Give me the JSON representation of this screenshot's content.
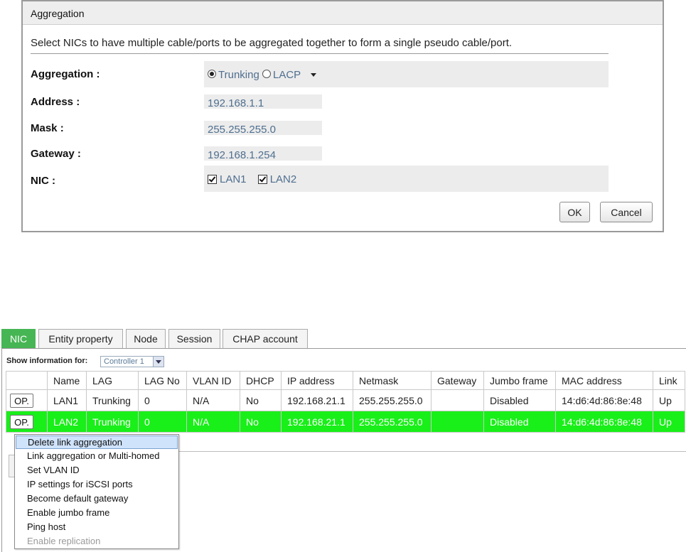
{
  "dialog": {
    "title": "Aggregation",
    "description": "Select NICs to have multiple cable/ports to be aggregated together to form a single pseudo cable/port.",
    "aggregation_label": "Aggregation :",
    "aggregation_options": [
      "Trunking",
      "LACP"
    ],
    "aggregation_selected": "Trunking",
    "address_label": "Address :",
    "address_value": "192.168.1.1",
    "mask_label": "Mask :",
    "mask_value": "255.255.255.0",
    "gateway_label": "Gateway :",
    "gateway_value": "192.168.1.254",
    "nic_label": "NIC :",
    "nic_options": [
      {
        "label": "LAN1",
        "checked": true
      },
      {
        "label": "LAN2",
        "checked": true
      }
    ],
    "ok_label": "OK",
    "cancel_label": "Cancel"
  },
  "tabs": [
    {
      "label": "NIC",
      "active": true
    },
    {
      "label": "Entity property",
      "active": false
    },
    {
      "label": "Node",
      "active": false
    },
    {
      "label": "Session",
      "active": false
    },
    {
      "label": "CHAP account",
      "active": false
    }
  ],
  "show_info": {
    "label": "Show information for:",
    "selected": "Controller 1"
  },
  "table": {
    "columns": [
      "",
      "Name",
      "LAG",
      "LAG No",
      "VLAN ID",
      "DHCP",
      "IP address",
      "Netmask",
      "Gateway",
      "Jumbo frame",
      "MAC address",
      "Link"
    ],
    "rows": [
      {
        "op": "OP.",
        "name": "LAN1",
        "lag": "Trunking",
        "lag_no": "0",
        "vlan_id": "N/A",
        "dhcp": "No",
        "ip": "192.168.21.1",
        "netmask": "255.255.255.0",
        "gateway": "",
        "jumbo": "Disabled",
        "mac": "14:d6:4d:86:8e:48",
        "link": "Up"
      },
      {
        "op": "OP.",
        "name": "LAN2",
        "lag": "Trunking",
        "lag_no": "0",
        "vlan_id": "N/A",
        "dhcp": "No",
        "ip": "192.168.21.1",
        "netmask": "255.255.255.0",
        "gateway": "",
        "jumbo": "Disabled",
        "mac": "14:d6:4d:86:8e:48",
        "link": "Up"
      }
    ]
  },
  "context_menu": {
    "items": [
      {
        "label": "Delete link aggregation",
        "highlighted": true,
        "disabled": false
      },
      {
        "label": "Link aggregation or Multi-homed",
        "highlighted": false,
        "disabled": false
      },
      {
        "label": "Set VLAN ID",
        "highlighted": false,
        "disabled": false
      },
      {
        "label": "IP settings for iSCSI ports",
        "highlighted": false,
        "disabled": false
      },
      {
        "label": "Become default gateway",
        "highlighted": false,
        "disabled": false
      },
      {
        "label": "Enable jumbo frame",
        "highlighted": false,
        "disabled": false
      },
      {
        "label": "Ping host",
        "highlighted": false,
        "disabled": false
      },
      {
        "label": "Enable replication",
        "highlighted": false,
        "disabled": true
      }
    ]
  },
  "colors": {
    "active_tab": "#46b553",
    "selected_row": "#19ef19",
    "field_text": "#4f6f8f",
    "menu_highlight": "#cfe3fb"
  }
}
